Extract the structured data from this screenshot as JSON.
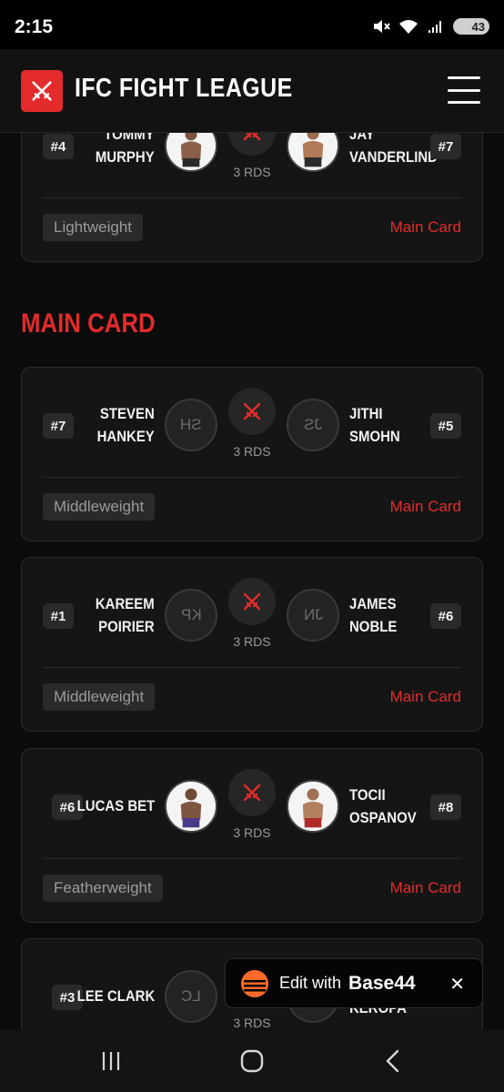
{
  "status_bar": {
    "time": "2:15",
    "battery": "43"
  },
  "header": {
    "brand": "IFC FIGHT LEAGUE"
  },
  "sections": {
    "main_card_title": "MAIN CARD"
  },
  "fights": [
    {
      "left": {
        "rank": "#4",
        "name1": "TOMMY",
        "name2": "MURPHY",
        "avatar": "photo"
      },
      "right": {
        "rank": "#7",
        "name1": "JAY",
        "name2": "VANDERLIND",
        "avatar": "photo"
      },
      "rounds": "3 RDS",
      "weight": "Lightweight",
      "card": "Main Card"
    },
    {
      "left": {
        "rank": "#7",
        "name1": "STEVEN",
        "name2": "HANKEY",
        "initials": "SH"
      },
      "right": {
        "rank": "#5",
        "name1": "JITHI",
        "name2": "SMOHN",
        "initials": "JS"
      },
      "rounds": "3 RDS",
      "weight": "Middleweight",
      "card": "Main Card"
    },
    {
      "left": {
        "rank": "#1",
        "name1": "KAREEM",
        "name2": "POIRIER",
        "initials": "KP"
      },
      "right": {
        "rank": "#6",
        "name1": "JAMES",
        "name2": "NOBLE",
        "initials": "JN"
      },
      "rounds": "3 RDS",
      "weight": "Middleweight",
      "card": "Main Card"
    },
    {
      "left": {
        "rank": "#6",
        "name1": "LUCAS BET",
        "avatar": "photo"
      },
      "right": {
        "rank": "#8",
        "name1": "TOCII",
        "name2": "OSPANOV",
        "avatar": "photo"
      },
      "rounds": "3 RDS",
      "weight": "Featherweight",
      "card": "Main Card"
    },
    {
      "left": {
        "rank": "#3",
        "name1": "LEE CLARK",
        "initials": "LC"
      },
      "right": {
        "name2": "KEROPA"
      },
      "rounds": "3 RDS"
    }
  ],
  "toast": {
    "text": "Edit with",
    "brand": "Base44"
  }
}
